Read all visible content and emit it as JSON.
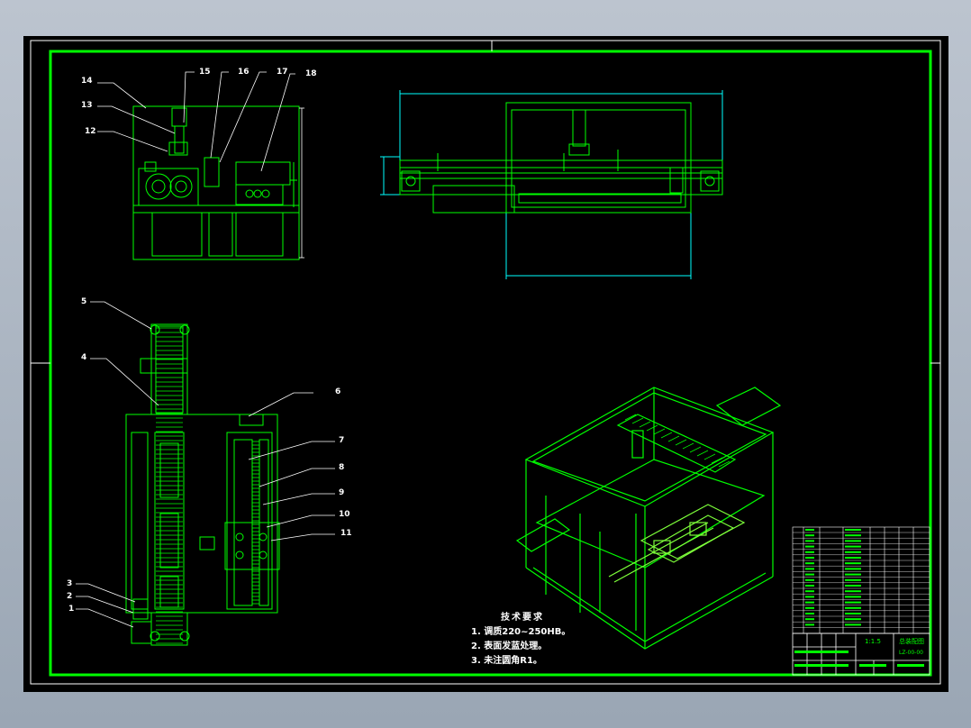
{
  "colors": {
    "frame_green": "#00ff00",
    "lime": "#7dff3a",
    "cyan": "#00ffff",
    "white": "#ffffff",
    "gray": "#9a9a9a",
    "background": "#000000"
  },
  "part_labels": [
    "1",
    "2",
    "3",
    "4",
    "5",
    "6",
    "7",
    "8",
    "9",
    "10",
    "11",
    "12",
    "13",
    "14",
    "15",
    "16",
    "17",
    "18"
  ],
  "technical_requirements": {
    "title": "技术要求",
    "items": [
      "1. 调质220~250HB。",
      "2. 表面发蓝处理。",
      "3. 未注圆角R1。"
    ]
  },
  "title_block": {
    "scale_text": "1:1.5",
    "name_text": "总装配图",
    "code_text": "LZ-00-00"
  }
}
